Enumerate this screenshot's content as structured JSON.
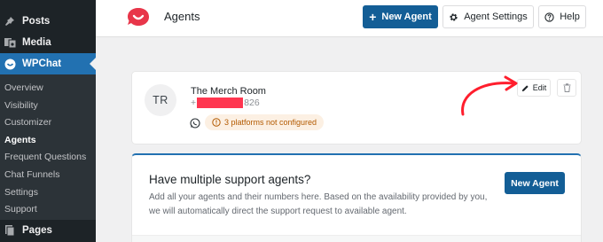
{
  "sidebar": {
    "top_items": [
      {
        "label": "Posts",
        "icon": "pin-icon"
      },
      {
        "label": "Media",
        "icon": "media-icon"
      },
      {
        "label": "WPChat",
        "icon": "chat-icon",
        "active": true
      },
      {
        "label": "Pages",
        "icon": "pages-icon"
      }
    ],
    "submenu": [
      {
        "label": "Overview"
      },
      {
        "label": "Visibility"
      },
      {
        "label": "Customizer"
      },
      {
        "label": "Agents",
        "current": true
      },
      {
        "label": "Frequent Questions"
      },
      {
        "label": "Chat Funnels"
      },
      {
        "label": "Settings"
      },
      {
        "label": "Support"
      }
    ],
    "colors": {
      "bg": "#1d2327",
      "active": "#2271b1"
    }
  },
  "header": {
    "title": "Agents",
    "logo_icon": "wpchat-logo-icon",
    "new_agent_label": "New Agent",
    "settings_label": "Agent Settings",
    "help_label": "Help"
  },
  "agent": {
    "initials": "TR",
    "name": "The Merch Room",
    "phone_prefix": "+",
    "phone_suffix": "826",
    "warning": "3 platforms not configured",
    "edit_label": "Edit"
  },
  "promo": {
    "title": "Have multiple support agents?",
    "description": "Add all your agents and their numbers here. Based on the availability provided by you, we will automatically direct the support request to available agent.",
    "button_label": "New Agent"
  },
  "colors": {
    "primary": "#135e96",
    "brand": "#e8364a",
    "annotation_arrow": "#ff1e2d",
    "warning_bg": "#fcf0e3",
    "warning_text": "#b35a00"
  }
}
